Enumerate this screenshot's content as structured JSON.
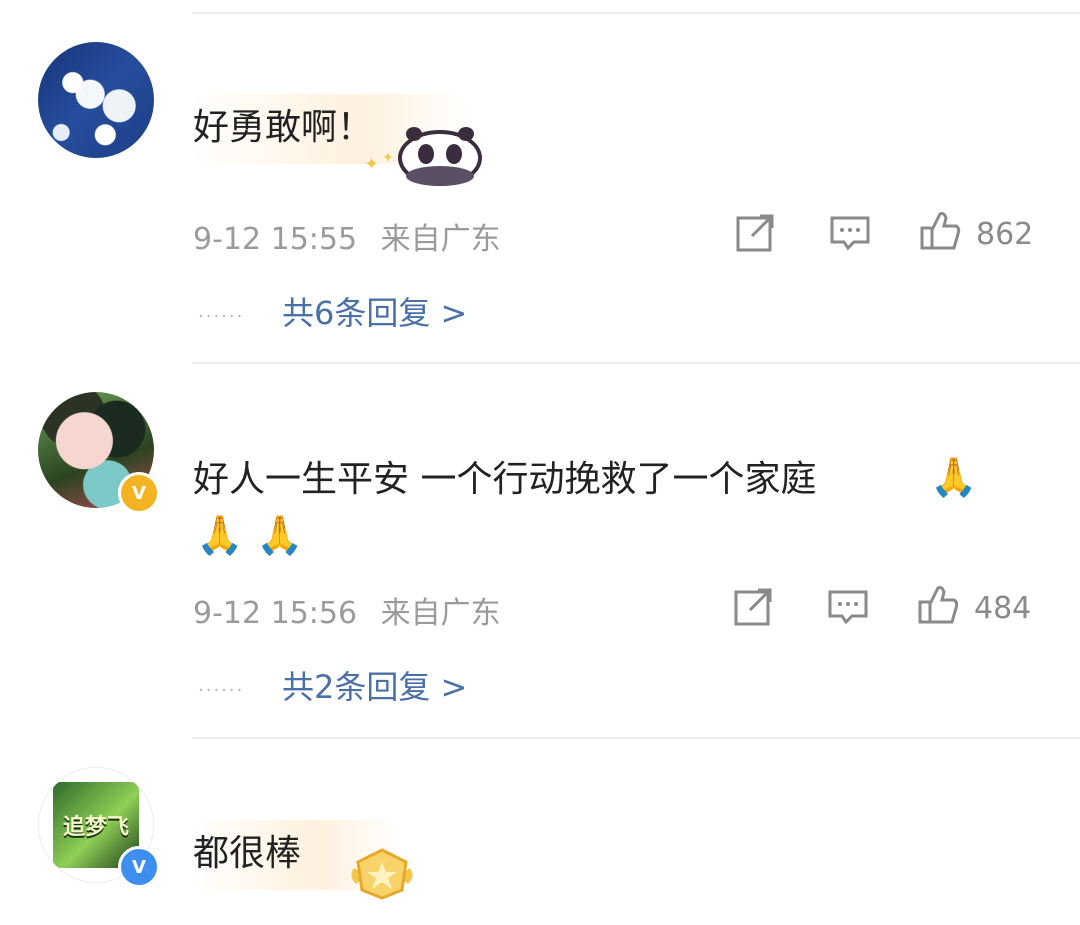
{
  "comments": [
    {
      "text": "好勇敢啊！",
      "timestamp": "9-12 15:55",
      "region": "来自广东",
      "likes": "862",
      "replies": "共6条回复 >",
      "sticker": "panda-sticker"
    },
    {
      "text": "好人一生平安  一个行动挽救了一个家庭",
      "timestamp": "9-12 15:56",
      "region": "来自广东",
      "likes": "484",
      "replies": "共2条回复 >",
      "emoji": "praying-hands-emoji",
      "badge": "gold-verified",
      "badge_label": "V"
    },
    {
      "text": "都很棒",
      "sticker": "star-badge-sticker",
      "badge": "blue-verified",
      "badge_label": "V",
      "logo_text": "追梦飞"
    }
  ],
  "icons": {
    "share": "share-icon",
    "comment": "comment-icon",
    "like": "thumbs-up-icon",
    "more_dots": "......"
  },
  "colors": {
    "reply_link": "#4a70a8",
    "meta_text": "#9b9b9b",
    "gold_badge": "#f4b323",
    "blue_badge": "#3e8ef0"
  }
}
